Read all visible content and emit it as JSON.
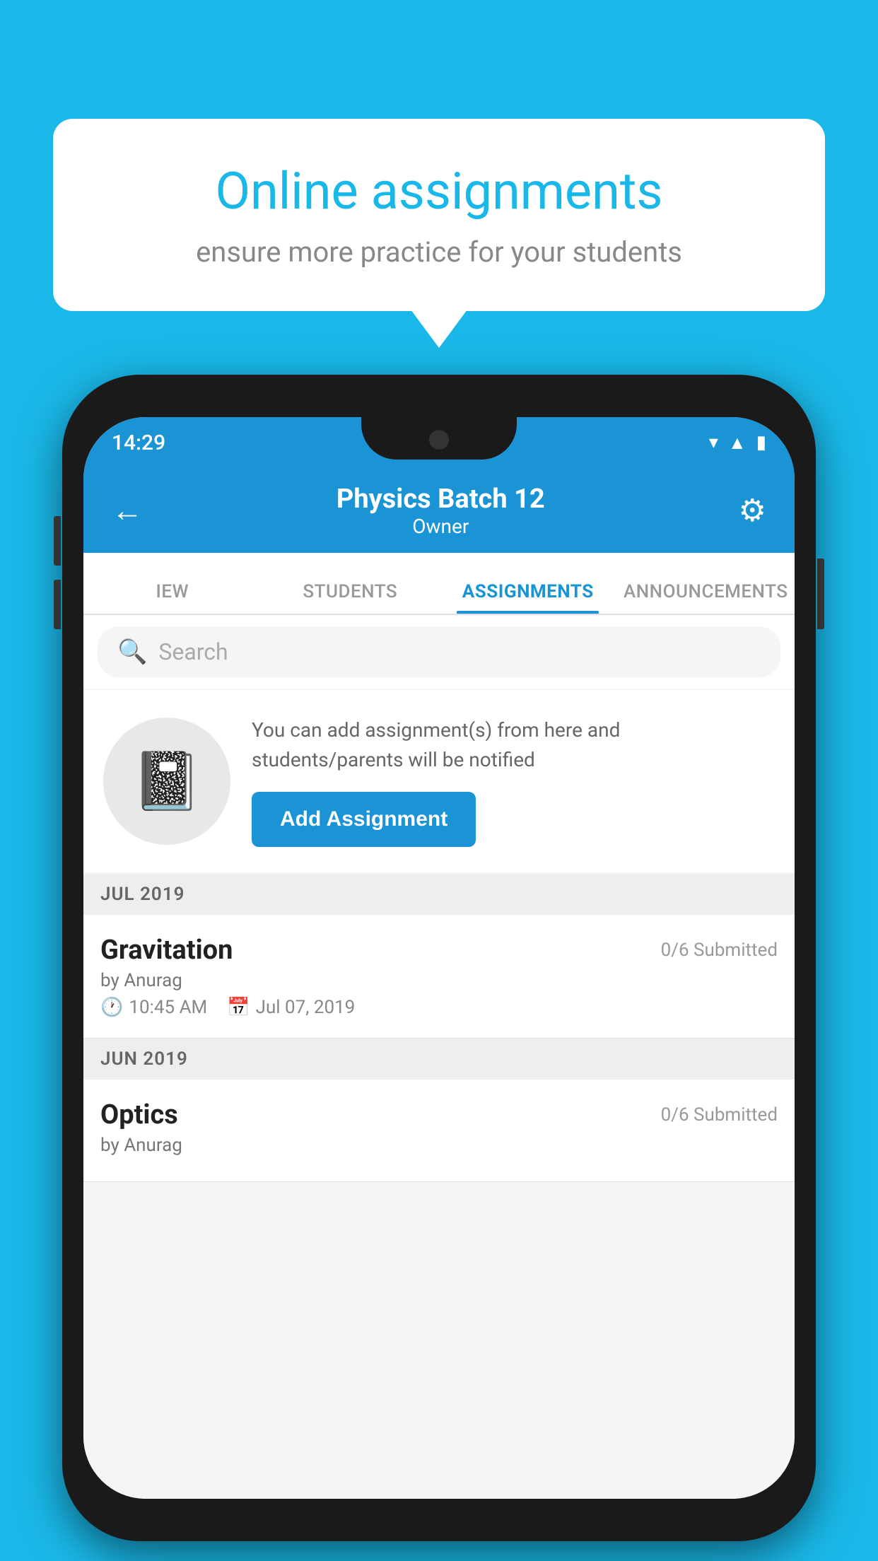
{
  "background_color": "#1ab8e8",
  "speech_bubble": {
    "title": "Online assignments",
    "subtitle": "ensure more practice for your students"
  },
  "phone": {
    "status_bar": {
      "time": "14:29",
      "icons": [
        "wifi",
        "signal",
        "battery"
      ]
    },
    "app_bar": {
      "title": "Physics Batch 12",
      "subtitle": "Owner",
      "back_label": "←",
      "settings_label": "⚙"
    },
    "tabs": [
      {
        "label": "IEW",
        "active": false
      },
      {
        "label": "STUDENTS",
        "active": false
      },
      {
        "label": "ASSIGNMENTS",
        "active": true
      },
      {
        "label": "ANNOUNCEMENTS",
        "active": false
      }
    ],
    "search": {
      "placeholder": "Search"
    },
    "info_card": {
      "description": "You can add assignment(s) from here and students/parents will be notified",
      "button_label": "Add Assignment"
    },
    "sections": [
      {
        "header": "JUL 2019",
        "assignments": [
          {
            "name": "Gravitation",
            "submitted": "0/6 Submitted",
            "by": "by Anurag",
            "time": "10:45 AM",
            "date": "Jul 07, 2019"
          }
        ]
      },
      {
        "header": "JUN 2019",
        "assignments": [
          {
            "name": "Optics",
            "submitted": "0/6 Submitted",
            "by": "by Anurag",
            "time": "",
            "date": ""
          }
        ]
      }
    ]
  }
}
